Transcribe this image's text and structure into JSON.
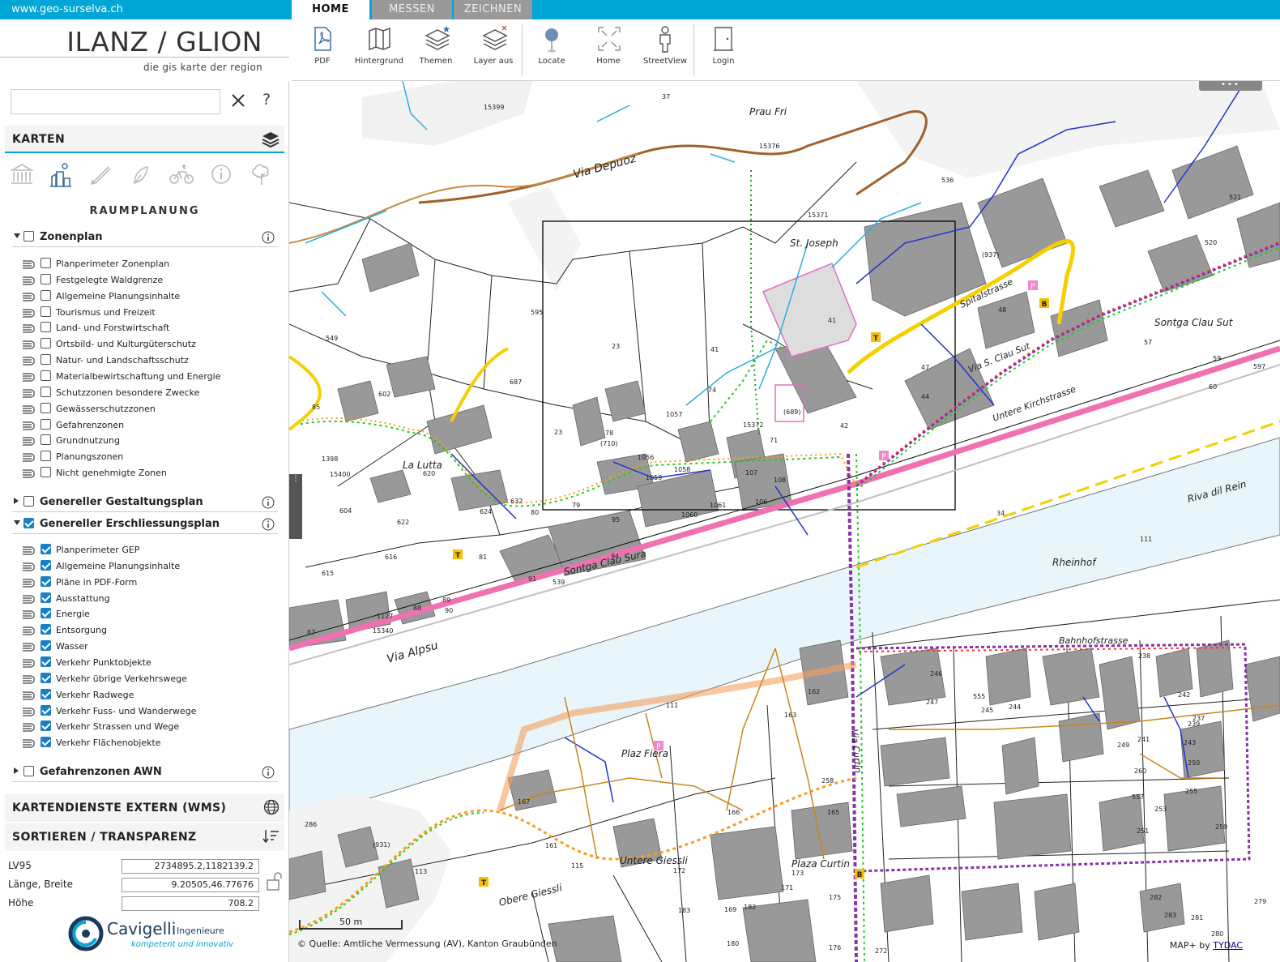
{
  "site_url": "www.geo-surselva.ch",
  "tabs": [
    "HOME",
    "MESSEN",
    "ZEICHNEN"
  ],
  "app_title": "ILANZ / GLION",
  "app_subtitle": "die gis karte der region",
  "toolbar": {
    "pdf": "PDF",
    "hintergrund": "Hintergrund",
    "themen": "Themen",
    "layer_aus": "Layer aus",
    "locate": "Locate",
    "home": "Home",
    "streetview": "StreetView",
    "login": "Login"
  },
  "search": {
    "placeholder": ""
  },
  "karten": {
    "title": "KARTEN",
    "subtitle": "RAUMPLANUNG"
  },
  "groups": {
    "zonenplan": {
      "label": "Zonenplan",
      "checked": false,
      "layers": [
        "Planperimeter Zonenplan",
        "Festgelegte Waldgrenze",
        "Allgemeine Planungsinhalte",
        "Tourismus und Freizeit",
        "Land- und Forstwirtschaft",
        "Ortsbild- und Kulturgüterschutz",
        "Natur- und Landschaftsschutz",
        "Materialbewirtschaftung und Energie",
        "Schutzzonen besondere Zwecke",
        "Gewässerschutzzonen",
        "Gefahrenzonen",
        "Grundnutzung",
        "Planungszonen",
        "Nicht genehmigte Zonen"
      ]
    },
    "gestaltungsplan": {
      "label": "Genereller Gestaltungsplan",
      "checked": false
    },
    "erschliessungsplan": {
      "label": "Genereller Erschliessungsplan",
      "checked": true,
      "layers": [
        "Planperimeter GEP",
        "Allgemeine Planungsinhalte",
        "Pläne in PDF-Form",
        "Ausstattung",
        "Energie",
        "Entsorgung",
        "Wasser",
        "Verkehr Punktobjekte",
        "Verkehr übrige Verkehrswege",
        "Verkehr Radwege",
        "Verkehr Fuss- und Wanderwege",
        "Verkehr Strassen und Wege",
        "Verkehr Flächenobjekte"
      ]
    },
    "gefahrenzonen_awn": {
      "label": "Gefahrenzonen AWN",
      "checked": false
    }
  },
  "wms_title": "KARTENDIENSTE EXTERN (WMS)",
  "sort_title": "SORTIEREN / TRANSPARENZ",
  "coords": {
    "lv95_label": "LV95",
    "lv95_value": "2734895.2,1182139.2",
    "lb_label": "Länge, Breite",
    "lb_value": "9.20505,46.77676",
    "hoehe_label": "Höhe",
    "hoehe_value": "708.2"
  },
  "logo": {
    "name": "Cavigelli",
    "name2": "Ingenieure",
    "tagline": "kompetent und innovativ"
  },
  "map": {
    "attribution": "© Quelle: Amtliche Vermessung (AV), Kanton Graubünden",
    "mapplus_prefix": "MAP+ by ",
    "mapplus_link": "TYDAC",
    "scale": "50 m",
    "menu": "•••",
    "handle": "⋮",
    "names": [
      "Via Depuoz",
      "Prau Fri",
      "St. Joseph",
      "Sontga Clau Sut",
      "La Lutta",
      "Sontga Clau Sura",
      "Rheinhof",
      "Via Alpsu",
      "Plaz Fiera",
      "Untere Giessli",
      "Plaza Curtin",
      "Obere Giessli",
      "Riva dil Rein",
      "Spitalstrasse",
      "Via S. Clau Sut",
      "Untere Kirchstrasse",
      "Bahnhofstrasse",
      "Via Curtin"
    ],
    "parcels": [
      "15399",
      "37",
      "15376",
      "536",
      "15371",
      "521",
      "520",
      "(937)",
      "41",
      "48",
      "57",
      "59",
      "47",
      "60",
      "597",
      "549",
      "595",
      "23",
      "41",
      "74",
      "44",
      "602",
      "687",
      "15372",
      "(689)",
      "42",
      "85",
      "1057",
      "78",
      "(710)",
      "71",
      "1398",
      "620",
      "1056",
      "1059",
      "1058",
      "107",
      "108",
      "15400",
      "23",
      "624",
      "632",
      "80",
      "79",
      "95",
      "1060",
      "1061",
      "106",
      "604",
      "622",
      "616",
      "81",
      "94",
      "539",
      "91",
      "615",
      "1127",
      "88",
      "89",
      "90",
      "87",
      "15340",
      "34",
      "111",
      "111",
      "162",
      "163",
      "246",
      "247",
      "555",
      "245",
      "244",
      "242",
      "239",
      "237",
      "238",
      "241",
      "249",
      "243",
      "260",
      "250",
      "557",
      "255",
      "253",
      "251",
      "259",
      "258",
      "165",
      "166",
      "167",
      "161",
      "(931)",
      "113",
      "115",
      "173",
      "171",
      "169",
      "175",
      "182",
      "183",
      "180",
      "176",
      "172",
      "282",
      "283",
      "281",
      "280",
      "279",
      "272",
      "286",
      "34"
    ]
  },
  "colors": {
    "accent": "#00a6d6",
    "checkbox": "#1a7fc4"
  }
}
